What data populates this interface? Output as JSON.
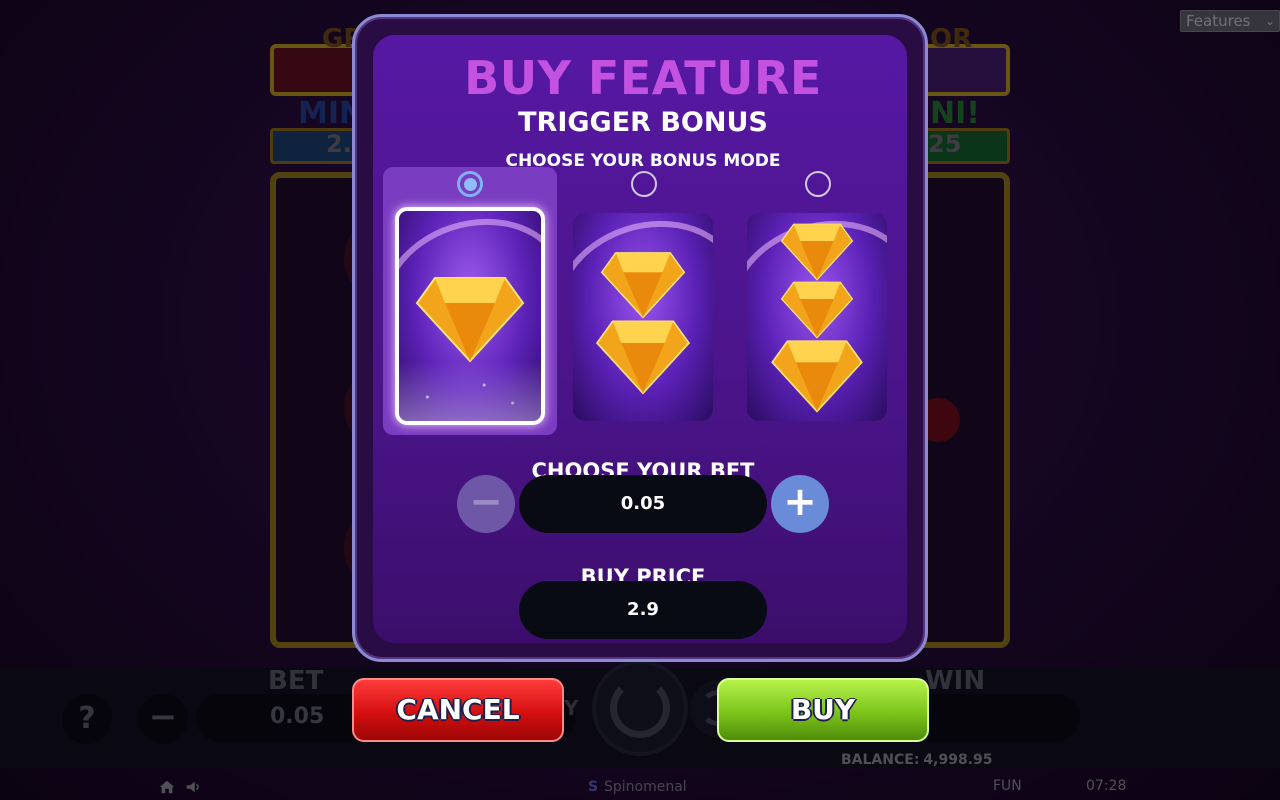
{
  "game": {
    "jackpot_left_title": "GR",
    "jackpot_right_title": "OR",
    "mini_left_label": "MIN",
    "mini_left_value": "2.",
    "mini_right_label": "NI!",
    "mini_right_value": "25"
  },
  "bottom_bar": {
    "help_label": "?",
    "bet_label": "BET",
    "bet_value": "0.05",
    "win_label": "WIN",
    "buy_hint": "Y",
    "balance_label": "BALANCE:",
    "balance_value": "4,998.95",
    "mode_label": "FUN",
    "clock": "07:28",
    "brand": "Spinomenal"
  },
  "features_select": {
    "selected": "Features"
  },
  "modal": {
    "title": "BUY FEATURE",
    "subtitle": "TRIGGER BONUS",
    "mode_heading": "CHOOSE YOUR BONUS MODE",
    "modes": [
      {
        "id": "mode-1",
        "gems": 1,
        "selected": true
      },
      {
        "id": "mode-2",
        "gems": 2,
        "selected": false
      },
      {
        "id": "mode-3",
        "gems": 3,
        "selected": false
      }
    ],
    "bet_heading": "CHOOSE YOUR BET",
    "bet_minus": "−",
    "bet_plus": "+",
    "bet_value": "0.05",
    "price_heading": "BUY PRICE",
    "price_value": "2.9"
  },
  "actions": {
    "cancel_label": "CANCEL",
    "buy_label": "BUY"
  },
  "colors": {
    "title_purple": "#c352e0",
    "cancel_red": "#d40f0f",
    "buy_green": "#7cc41a",
    "radio_selected": "#8fbbff"
  }
}
